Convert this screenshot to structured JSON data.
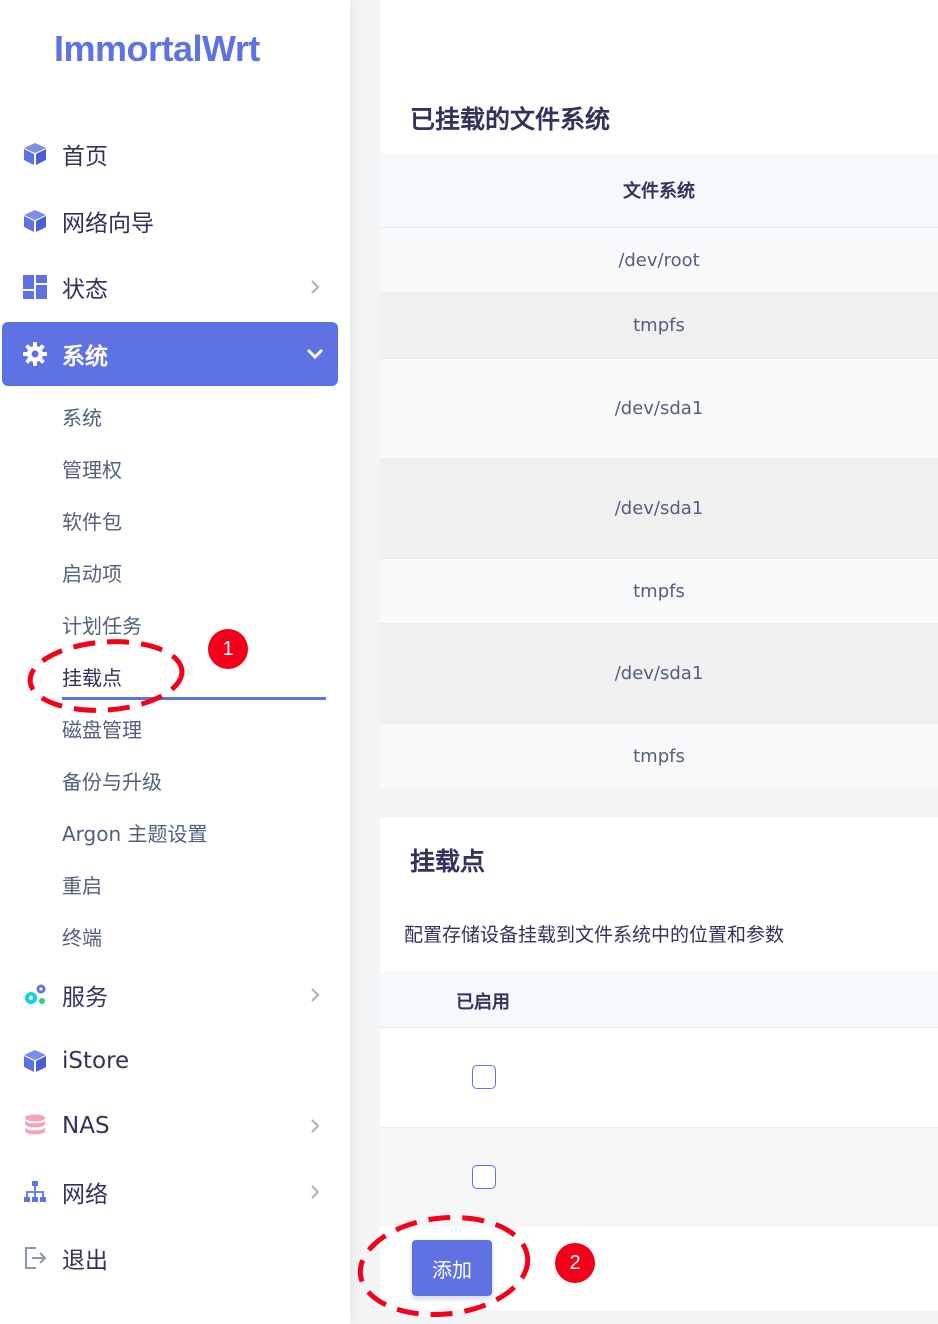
{
  "app": {
    "logo": "ImmortalWrt"
  },
  "sidebar": {
    "items": [
      {
        "label": "首页",
        "icon": "cube-icon"
      },
      {
        "label": "网络向导",
        "icon": "cube-icon"
      },
      {
        "label": "状态",
        "icon": "dashboard-icon",
        "has_submenu": true
      },
      {
        "label": "系统",
        "icon": "gear-icon",
        "has_submenu": true,
        "expanded": true
      },
      {
        "label": "服务",
        "icon": "gears-icon",
        "has_submenu": true
      },
      {
        "label": "iStore",
        "icon": "cube-icon"
      },
      {
        "label": "NAS",
        "icon": "database-icon",
        "has_submenu": true
      },
      {
        "label": "网络",
        "icon": "sitemap-icon",
        "has_submenu": true
      },
      {
        "label": "退出",
        "icon": "logout-icon"
      }
    ],
    "system_submenu": [
      "系统",
      "管理权",
      "软件包",
      "启动项",
      "计划任务",
      "挂载点",
      "磁盘管理",
      "备份与升级",
      "Argon 主题设置",
      "重启",
      "终端"
    ],
    "active_submenu": "挂载点"
  },
  "mounted_fs": {
    "title": "已挂载的文件系统",
    "column": "文件系统",
    "rows": [
      "/dev/root",
      "tmpfs",
      "/dev/sda1",
      "/dev/sda1",
      "tmpfs",
      "/dev/sda1",
      "tmpfs"
    ]
  },
  "mount_points": {
    "title": "挂载点",
    "description": "配置存储设备挂载到文件系统中的位置和参数",
    "column": "已启用",
    "rows": [
      {
        "enabled": false
      },
      {
        "enabled": false
      }
    ],
    "add_button": "添加"
  },
  "annotations": {
    "badge1": "1",
    "badge2": "2"
  },
  "colors": {
    "accent": "#5e72e4",
    "annotation_red": "#f5001b"
  }
}
